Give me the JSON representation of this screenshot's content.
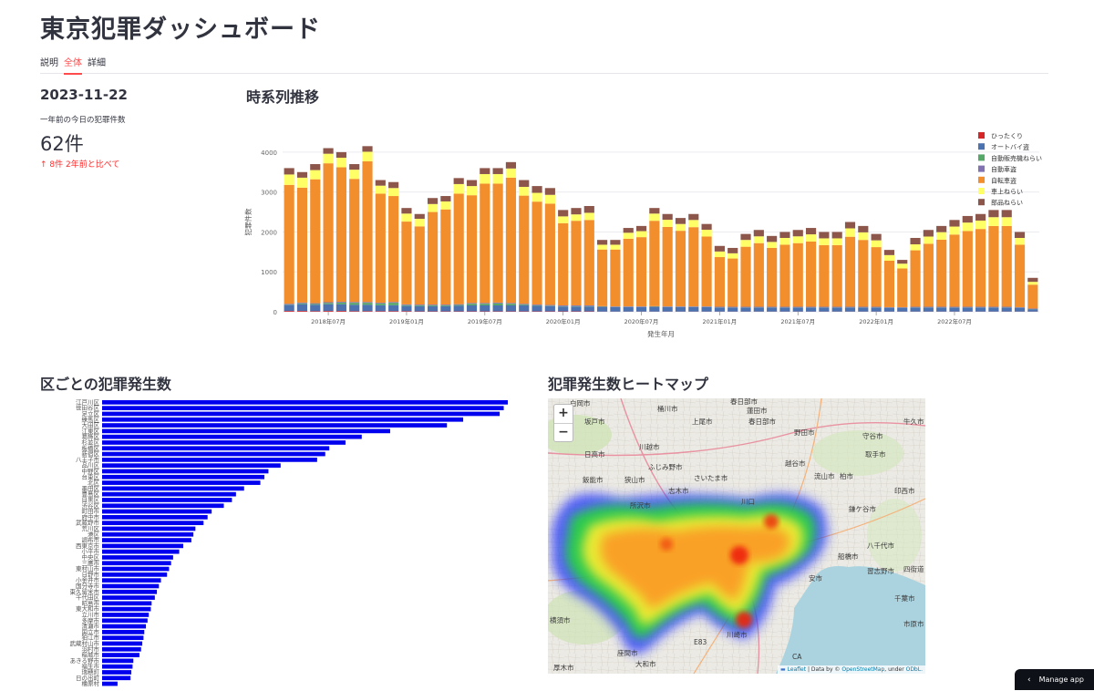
{
  "title": "東京犯罪ダッシュボード",
  "tabs": [
    {
      "label": "説明"
    },
    {
      "label": "全体"
    },
    {
      "label": "詳細"
    }
  ],
  "summary": {
    "date": "2023-11-22",
    "label": "一年前の今日の犯罪件数",
    "value": "62件",
    "delta": "8件 2年前と比べて",
    "delta_color": "#ff2b2b"
  },
  "section_titles": {
    "timeseries": "時系列推移",
    "ward": "区ごとの犯罪発生数",
    "heatmap": "犯罪発生数ヒートマップ"
  },
  "chart_data": [
    {
      "type": "bar",
      "stacked": true,
      "title": "",
      "xlabel": "発生年月",
      "ylabel": "犯罪件数",
      "ylim": [
        0,
        4500
      ],
      "yticks": [
        0,
        1000,
        2000,
        3000,
        4000
      ],
      "xtick_labels": [
        "2018年07月",
        "2019年01月",
        "2019年07月",
        "2020年01月",
        "2020年07月",
        "2021年01月",
        "2021年07月",
        "2022年01月",
        "2022年07月"
      ],
      "xtick_index": [
        3,
        9,
        15,
        21,
        27,
        33,
        39,
        45,
        51
      ],
      "legend_position": "top-right",
      "legend_order": [
        "ひったくり",
        "オートバイ盗",
        "自動販売機ねらい",
        "自動車盗",
        "自転車盗",
        "車上ねらい",
        "部品ねらい"
      ],
      "series_colors": {
        "ひったくり": "#d62728",
        "オートバイ盗": "#4c72b0",
        "自動販売機ねらい": "#55a868",
        "自動車盗": "#8172b2",
        "自転車盗": "#f28e2b",
        "車上ねらい": "#ffff66",
        "部品ねらい": "#8c564b"
      },
      "totals": [
        3600,
        3500,
        3700,
        4100,
        4000,
        3700,
        4150,
        3300,
        3250,
        2600,
        2450,
        2850,
        2900,
        3350,
        3300,
        3600,
        3600,
        3750,
        3300,
        3150,
        3100,
        2550,
        2600,
        2650,
        1800,
        1800,
        2100,
        2150,
        2600,
        2450,
        2350,
        2450,
        2200,
        1650,
        1600,
        1950,
        2050,
        1900,
        2000,
        2050,
        2100,
        2000,
        2000,
        2250,
        2150,
        1950,
        1550,
        1300,
        1850,
        2050,
        2150,
        2300,
        2400,
        2450,
        2550,
        2550,
        2000,
        850
      ],
      "series": [
        {
          "name": "ひったくり",
          "values": [
            20,
            20,
            15,
            20,
            20,
            15,
            15,
            15,
            15,
            15,
            10,
            10,
            10,
            10,
            10,
            10,
            10,
            10,
            10,
            10,
            10,
            10,
            10,
            10,
            5,
            5,
            5,
            5,
            5,
            5,
            5,
            5,
            5,
            5,
            5,
            5,
            5,
            5,
            5,
            5,
            5,
            5,
            5,
            5,
            5,
            5,
            5,
            5,
            5,
            5,
            5,
            5,
            5,
            5,
            5,
            5,
            5,
            5
          ]
        },
        {
          "name": "オートバイ盗",
          "values": [
            150,
            170,
            160,
            170,
            170,
            160,
            160,
            150,
            150,
            130,
            130,
            130,
            130,
            140,
            150,
            150,
            150,
            150,
            150,
            140,
            130,
            120,
            120,
            120,
            110,
            110,
            110,
            110,
            110,
            110,
            110,
            110,
            110,
            100,
            100,
            100,
            100,
            100,
            100,
            100,
            100,
            100,
            100,
            100,
            100,
            100,
            90,
            90,
            100,
            100,
            100,
            100,
            100,
            100,
            100,
            100,
            90,
            60
          ]
        },
        {
          "name": "自動販売機ねらい",
          "values": [
            10,
            20,
            20,
            30,
            40,
            50,
            50,
            40,
            60,
            20,
            20,
            20,
            20,
            20,
            40,
            40,
            50,
            40,
            20,
            10,
            10,
            10,
            10,
            10,
            10,
            5,
            5,
            5,
            10,
            5,
            5,
            5,
            5,
            5,
            5,
            5,
            5,
            5,
            5,
            5,
            5,
            5,
            5,
            5,
            5,
            5,
            5,
            5,
            5,
            5,
            5,
            5,
            5,
            5,
            5,
            5,
            5,
            5
          ]
        },
        {
          "name": "自動車盗",
          "values": [
            20,
            20,
            20,
            20,
            20,
            20,
            20,
            20,
            20,
            20,
            20,
            20,
            20,
            20,
            20,
            20,
            20,
            20,
            20,
            20,
            20,
            20,
            20,
            20,
            15,
            15,
            15,
            15,
            15,
            15,
            15,
            15,
            15,
            15,
            15,
            15,
            15,
            15,
            15,
            15,
            15,
            15,
            15,
            15,
            15,
            15,
            15,
            15,
            15,
            15,
            15,
            15,
            15,
            15,
            15,
            15,
            15,
            10
          ]
        },
        {
          "name": "自転車盗",
          "values": [
            2980,
            2880,
            3105,
            3480,
            3370,
            3085,
            3525,
            2735,
            2655,
            2075,
            1960,
            2320,
            2385,
            2770,
            2700,
            2990,
            2980,
            3140,
            2710,
            2580,
            2540,
            2060,
            2120,
            2140,
            1420,
            1425,
            1695,
            1735,
            2140,
            1990,
            1895,
            1985,
            1750,
            1245,
            1210,
            1505,
            1595,
            1475,
            1555,
            1595,
            1635,
            1545,
            1545,
            1755,
            1675,
            1495,
            1165,
            970,
            1415,
            1580,
            1680,
            1810,
            1900,
            1950,
            2025,
            2025,
            1565,
            600
          ]
        },
        {
          "name": "車上ねらい",
          "values": [
            260,
            250,
            230,
            240,
            240,
            230,
            240,
            200,
            200,
            200,
            190,
            200,
            200,
            240,
            230,
            240,
            240,
            230,
            220,
            220,
            220,
            170,
            160,
            180,
            120,
            120,
            150,
            150,
            180,
            180,
            170,
            180,
            170,
            140,
            130,
            170,
            170,
            150,
            170,
            170,
            180,
            170,
            170,
            210,
            190,
            170,
            140,
            120,
            150,
            180,
            190,
            200,
            210,
            210,
            220,
            220,
            170,
            70
          ]
        },
        {
          "name": "部品ねらい",
          "values": [
            160,
            140,
            150,
            140,
            140,
            140,
            140,
            140,
            150,
            140,
            120,
            150,
            135,
            150,
            150,
            150,
            150,
            160,
            170,
            170,
            170,
            160,
            160,
            170,
            120,
            120,
            120,
            130,
            140,
            145,
            150,
            150,
            145,
            140,
            135,
            150,
            160,
            150,
            150,
            160,
            160,
            160,
            160,
            160,
            160,
            160,
            130,
            95,
            160,
            165,
            155,
            165,
            165,
            165,
            180,
            180,
            150,
            100
          ]
        }
      ]
    },
    {
      "type": "bar",
      "orientation": "horizontal",
      "title": "",
      "xlabel": "",
      "ylabel": "",
      "bar_color": "#0000ee",
      "categories": [
        "江戸川区",
        "世田谷区",
        "足立区",
        "練馬区",
        "大田区",
        "江東区",
        "葛飾区",
        "杉並区",
        "板橋区",
        "新宿区",
        "八王子市",
        "品川区",
        "中野区",
        "台東区",
        "北区",
        "墨田区",
        "豊島区",
        "目黒区",
        "渋谷区",
        "町田市",
        "府中市",
        "武蔵野市",
        "荒川区",
        "港区",
        "調布市",
        "西東京市",
        "小平市",
        "中央区",
        "三鷹市",
        "東村山市",
        "日野市",
        "小金井市",
        "国分寺市",
        "東久留米市",
        "千代田区",
        "昭島市",
        "東大和市",
        "立川市",
        "多摩市",
        "清瀬市",
        "国立市",
        "狛江市",
        "武蔵村山市",
        "羽村市",
        "稲城市",
        "あきる野市",
        "福生市",
        "瑞穂町",
        "日の出町",
        "檜原村"
      ],
      "values": [
        1000,
        990,
        980,
        890,
        850,
        710,
        640,
        600,
        560,
        550,
        530,
        440,
        410,
        400,
        390,
        350,
        330,
        320,
        300,
        270,
        260,
        250,
        230,
        225,
        220,
        200,
        190,
        175,
        170,
        165,
        160,
        145,
        140,
        135,
        130,
        122,
        120,
        115,
        112,
        108,
        104,
        102,
        99,
        96,
        92,
        77,
        75,
        72,
        70,
        38
      ],
      "xlim": [
        0,
        1000
      ]
    }
  ],
  "map": {
    "zoom_in": "+",
    "zoom_out": "−",
    "place_labels": [
      "白岡市",
      "春日部市",
      "桶川市",
      "蓮田市",
      "坂戸市",
      "上尾市",
      "春日部市",
      "野田市",
      "牛久市",
      "日高市",
      "川越市",
      "守谷市",
      "ふじみ野市",
      "越谷市",
      "取手市",
      "飯能市",
      "狭山市",
      "さいたま市",
      "流山市",
      "柏市",
      "志木市",
      "所沢市",
      "印西市",
      "川口",
      "鎌ケ谷市",
      "八千代市",
      "船橋市",
      "習志野市",
      "四街道",
      "千葉市",
      "市原市",
      "横須市",
      "厚木市",
      "座間市",
      "大和市",
      "川崎市",
      "CA",
      "E83",
      "安市"
    ],
    "attribution": {
      "leaflet": "Leaflet",
      "data_by": "| Data by ©",
      "osm": "OpenStreetMap",
      "under": ", under",
      "odbl": "ODbL."
    }
  },
  "manage_app": {
    "label": "Manage app",
    "icon": "chevron-left-icon"
  }
}
